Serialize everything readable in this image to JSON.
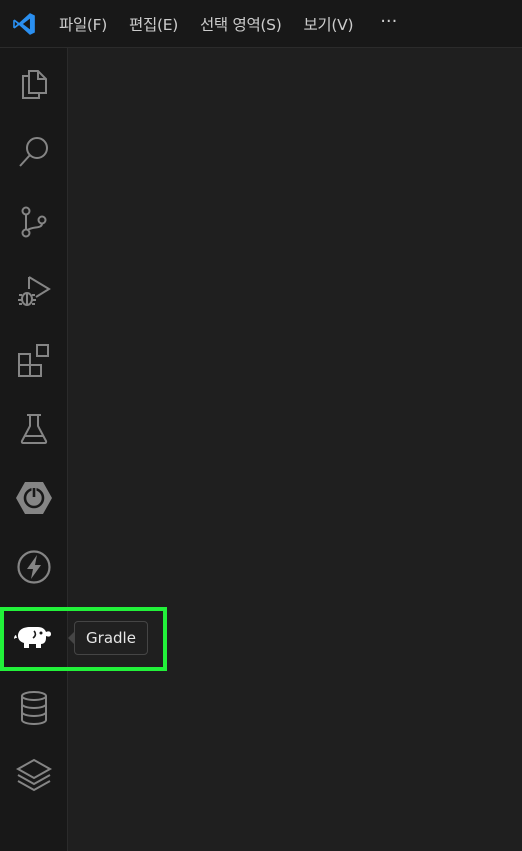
{
  "menubar": {
    "items": [
      "파일(F)",
      "편집(E)",
      "선택 영역(S)",
      "보기(V)"
    ],
    "more_label": "···"
  },
  "activity_bar": {
    "icons": [
      "explorer-icon",
      "search-icon",
      "source-control-icon",
      "run-debug-icon",
      "extensions-icon",
      "testing-icon",
      "spring-boot-icon",
      "thunder-client-icon",
      "gradle-icon",
      "database-icon",
      "layers-icon"
    ]
  },
  "tooltip": {
    "text": "Gradle"
  },
  "colors": {
    "highlight": "#22f13a",
    "vscode_blue": "#2a8ff0",
    "icon": "#858585"
  }
}
